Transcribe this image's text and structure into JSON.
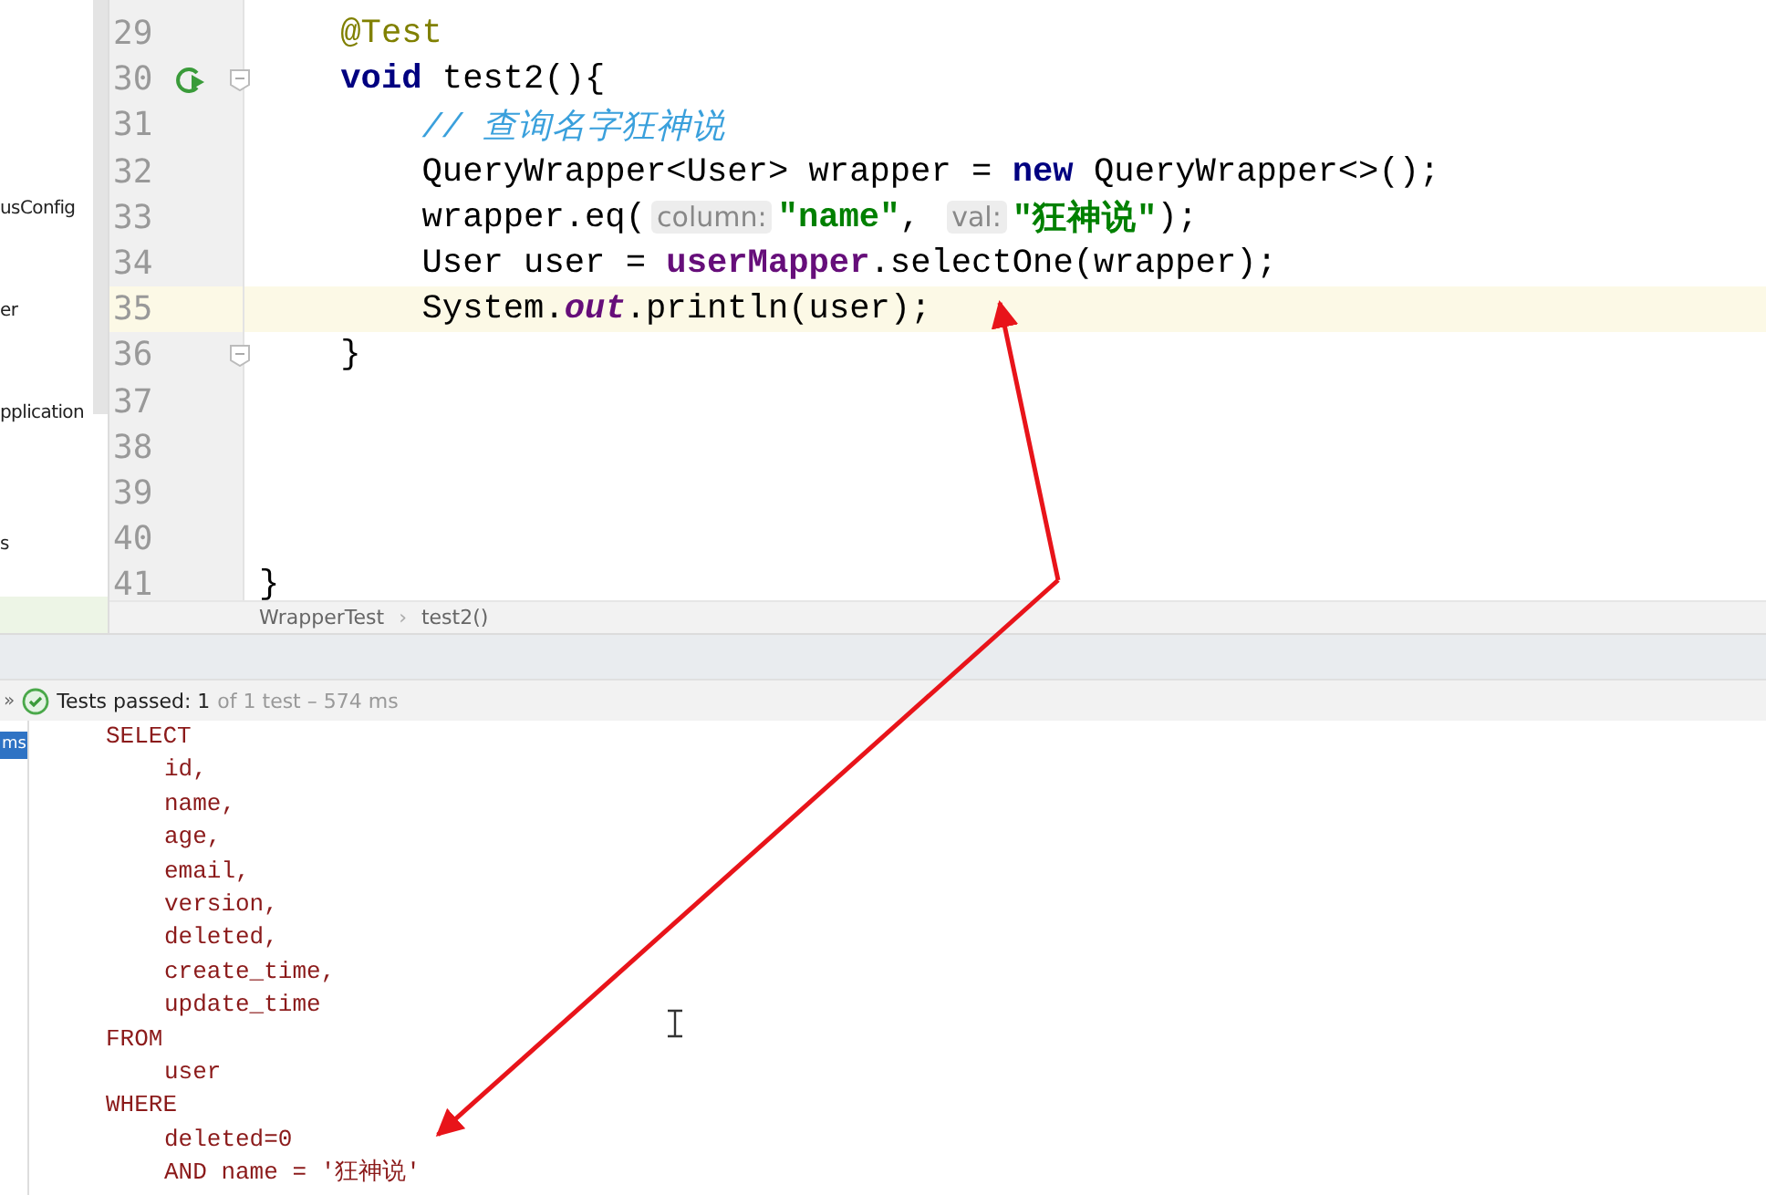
{
  "project_tree": {
    "items": [
      {
        "label": "usConfig"
      },
      {
        "label": "er"
      },
      {
        "label": "pplication"
      },
      {
        "label": "s"
      }
    ]
  },
  "editor": {
    "lines": [
      {
        "number": "29",
        "current": false,
        "tokens": [
          {
            "kind": "annotation",
            "text": "    @Test"
          }
        ]
      },
      {
        "number": "30",
        "current": false,
        "markers": [
          {
            "kind": "run"
          },
          {
            "kind": "fold"
          }
        ],
        "tokens": [
          {
            "kind": "keyword",
            "text": "    void"
          },
          {
            "kind": "plain",
            "text": " test2(){"
          }
        ]
      },
      {
        "number": "31",
        "current": false,
        "tokens": [
          {
            "kind": "comment",
            "text": "        // 查询名字狂神说"
          }
        ]
      },
      {
        "number": "32",
        "current": false,
        "tokens": [
          {
            "kind": "plain",
            "text": "        QueryWrapper<User> wrapper = "
          },
          {
            "kind": "keyword",
            "text": "new"
          },
          {
            "kind": "plain",
            "text": " QueryWrapper<>();"
          }
        ]
      },
      {
        "number": "33",
        "current": false,
        "tokens": [
          {
            "kind": "plain",
            "text": "        wrapper.eq("
          },
          {
            "kind": "hint",
            "text": "column:"
          },
          {
            "kind": "string",
            "text": "\"name\""
          },
          {
            "kind": "plain",
            "text": ", "
          },
          {
            "kind": "hint",
            "text": "val:"
          },
          {
            "kind": "string",
            "text": "\"狂神说\""
          },
          {
            "kind": "plain",
            "text": ");"
          }
        ]
      },
      {
        "number": "34",
        "current": false,
        "tokens": [
          {
            "kind": "plain",
            "text": "        User user = "
          },
          {
            "kind": "field",
            "text": "userMapper"
          },
          {
            "kind": "plain",
            "text": ".selectOne(wrapper);"
          }
        ]
      },
      {
        "number": "35",
        "current": true,
        "tokens": [
          {
            "kind": "plain",
            "text": "        System."
          },
          {
            "kind": "static",
            "text": "out"
          },
          {
            "kind": "plain",
            "text": ".println(user);"
          }
        ]
      },
      {
        "number": "36",
        "current": false,
        "markers": [
          {
            "kind": "fold"
          }
        ],
        "tokens": [
          {
            "kind": "plain",
            "text": "    }"
          }
        ]
      },
      {
        "number": "37",
        "current": false
      },
      {
        "number": "38",
        "current": false
      },
      {
        "number": "39",
        "current": false
      },
      {
        "number": "40",
        "current": false
      },
      {
        "number": "41",
        "current": false,
        "tokens": [
          {
            "kind": "plain",
            "text": "}"
          }
        ]
      }
    ],
    "breadcrumb": [
      {
        "kind": "item",
        "text": "WrapperTest"
      },
      {
        "kind": "separator",
        "text": "›"
      },
      {
        "kind": "item",
        "text": "test2()"
      }
    ]
  },
  "test_bar": {
    "expand_glyph": "»",
    "status": "Tests passed: 1",
    "detail": "of 1 test – 574 ms"
  },
  "console": {
    "side_label": "ms",
    "lines": [
      {
        "text": "SELECT",
        "children": [
          {
            "text": "id,"
          },
          {
            "text": "name,"
          },
          {
            "text": "age,"
          },
          {
            "text": "email,"
          },
          {
            "text": "version,"
          },
          {
            "text": "deleted,"
          },
          {
            "text": "create_time,"
          },
          {
            "text": "update_time"
          }
        ]
      },
      {
        "text": "FROM",
        "children": [
          {
            "text": "user"
          }
        ]
      },
      {
        "text": "WHERE",
        "children": [
          {
            "text": "deleted=0"
          },
          {
            "text": "AND name = '狂神说'"
          }
        ]
      }
    ]
  }
}
